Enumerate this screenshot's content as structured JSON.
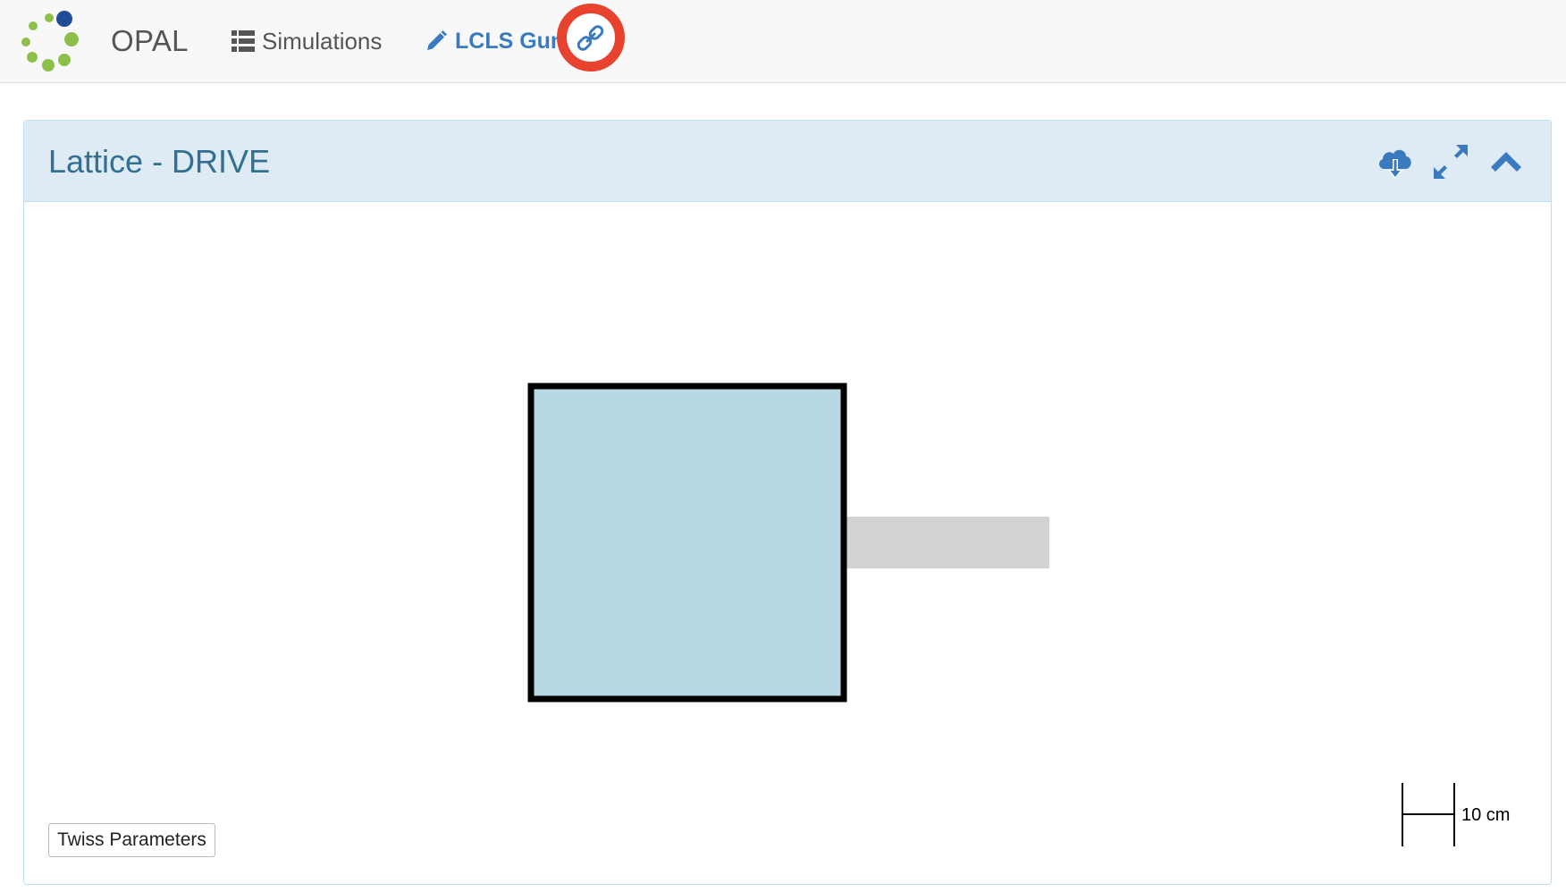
{
  "navbar": {
    "brand": "OPAL",
    "simulations_label": "Simulations",
    "simulation_name": "LCLS Gun",
    "icons": {
      "logo": "opal-logo-icon",
      "simulations": "list-icon",
      "edit": "pencil-icon",
      "link": "link-icon"
    }
  },
  "panel": {
    "title": "Lattice - DRIVE",
    "buttons": [
      "cloud-download-icon",
      "expand-icon",
      "chevron-up-icon"
    ],
    "twiss_button": "Twiss Parameters",
    "scale_label": "10 cm"
  },
  "colors": {
    "accent": "#3a7bbf",
    "highlight_ring": "#e8432e",
    "panel_heading_bg": "#deebf5",
    "panel_title": "#31708f",
    "element_fill": "#b7d7e2",
    "drift_fill": "#d3d3d3"
  }
}
